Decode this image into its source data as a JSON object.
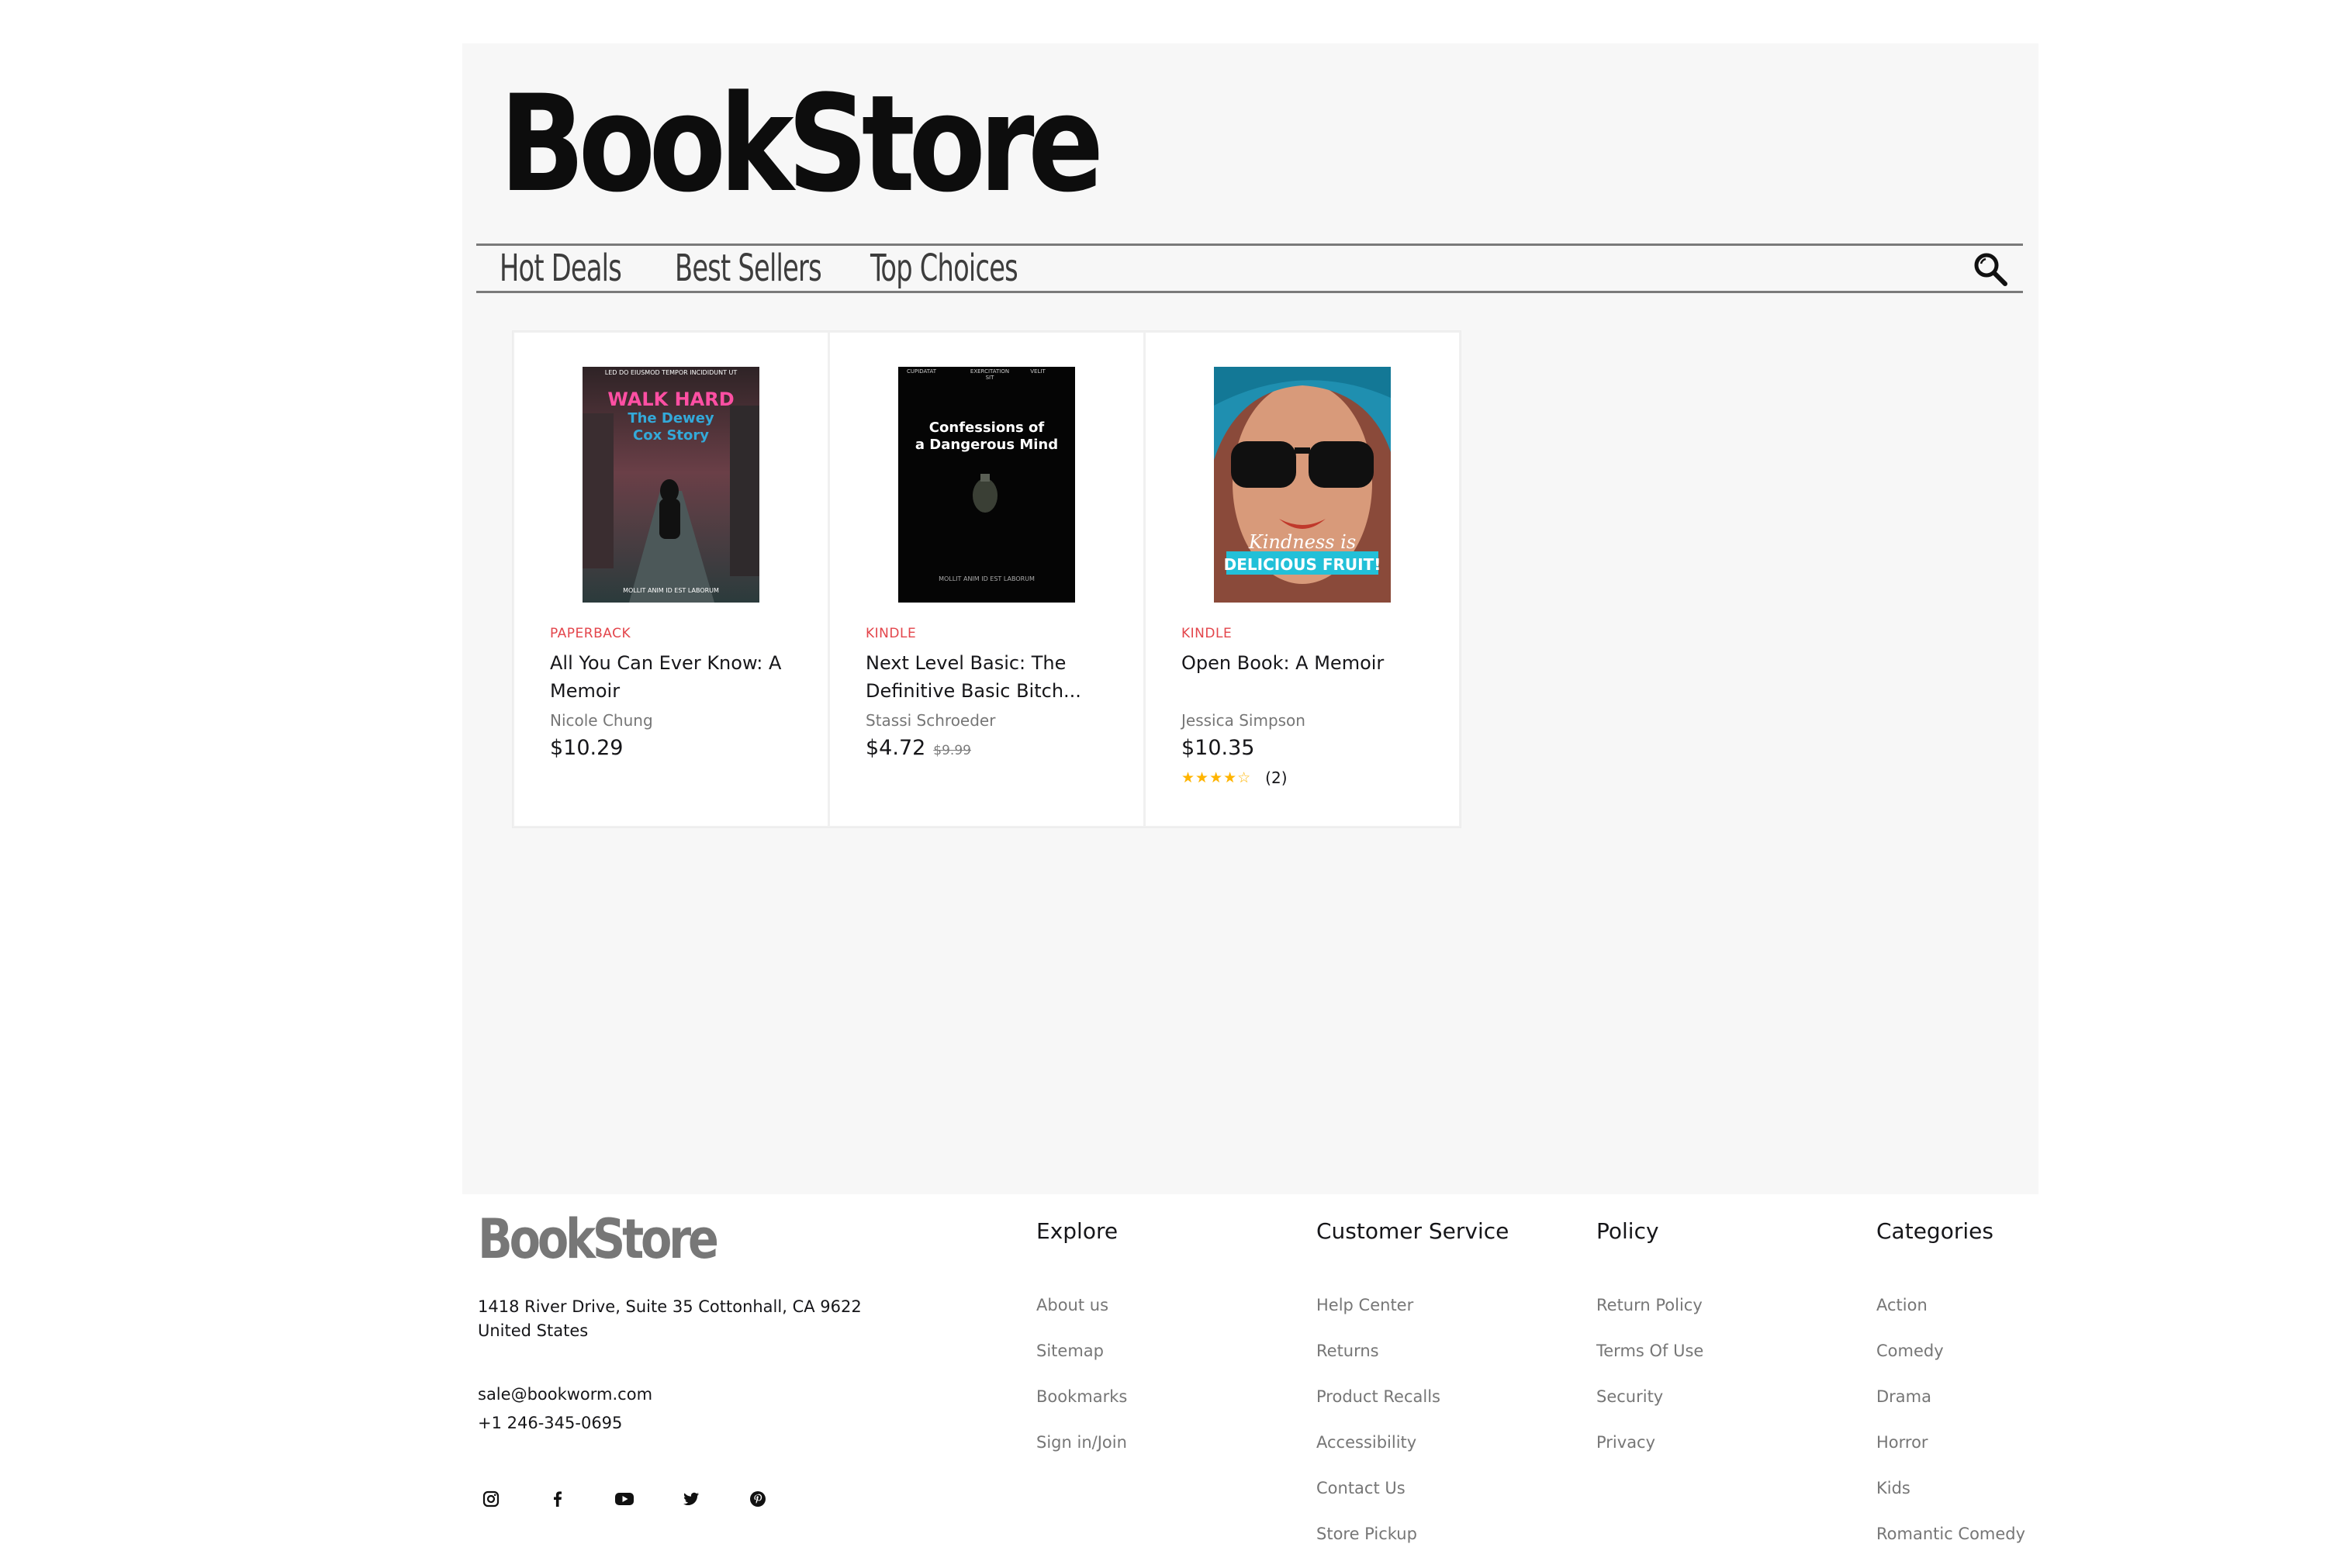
{
  "header": {
    "logo": "BookStore",
    "nav": [
      "Hot Deals",
      "Best Sellers",
      "Top Choices"
    ]
  },
  "products": [
    {
      "format": "PAPERBACK",
      "title": "All You Can Ever Know: A Memoir",
      "author": "Nicole Chung",
      "price": "$10.29",
      "cover": {
        "top": "LED DO EIUSMOD TEMPOR INCIDIDUNT UT",
        "title1": "WALK HARD",
        "title2": "The Dewey",
        "title3": "Cox Story",
        "bottom": "MOLLIT ANIM ID EST LABORUM"
      }
    },
    {
      "format": "KINDLE",
      "title": "Next Level Basic: The Definitive Basic Bitch...",
      "author": "Stassi Schroeder",
      "price": "$4.72",
      "old_price": "$9.99",
      "cover": {
        "top1": "CUPIDATAT",
        "top2": "EXERCITATION",
        "top3": "SIT",
        "top4": "VELIT",
        "title1": "Confessions of",
        "title2": "a Dangerous Mind",
        "bottom": "MOLLIT ANIM ID EST LABORUM"
      }
    },
    {
      "format": "KINDLE",
      "title": "Open Book: A Memoir",
      "author": "Jessica Simpson",
      "price": "$10.35",
      "rating": 4,
      "rating_max": 5,
      "review_count": "(2)",
      "cover": {
        "line1": "Kindness is",
        "line2": "DELICIOUS FRUIT!"
      }
    }
  ],
  "footer": {
    "logo": "BookStore",
    "address_line1": "1418 River Drive, Suite 35 Cottonhall, CA 9622",
    "address_line2": "United States",
    "email": "sale@bookworm.com",
    "phone": "+1 246-345-0695",
    "socials": [
      "instagram-icon",
      "facebook-icon",
      "youtube-icon",
      "twitter-icon",
      "pinterest-icon"
    ],
    "columns": [
      {
        "title": "Explore",
        "links": [
          "About us",
          "Sitemap",
          "Bookmarks",
          "Sign in/Join"
        ]
      },
      {
        "title": "Customer Service",
        "links": [
          "Help Center",
          "Returns",
          "Product Recalls",
          "Accessibility",
          "Contact Us",
          "Store Pickup"
        ]
      },
      {
        "title": "Policy",
        "links": [
          "Return Policy",
          "Terms Of Use",
          "Security",
          "Privacy"
        ]
      },
      {
        "title": "Categories",
        "links": [
          "Action",
          "Comedy",
          "Drama",
          "Horror",
          "Kids",
          "Romantic Comedy"
        ]
      }
    ]
  },
  "colors": {
    "accent": "#e3454b",
    "star": "#ffb400",
    "panel": "#f7f7f7",
    "muted": "#767676"
  }
}
